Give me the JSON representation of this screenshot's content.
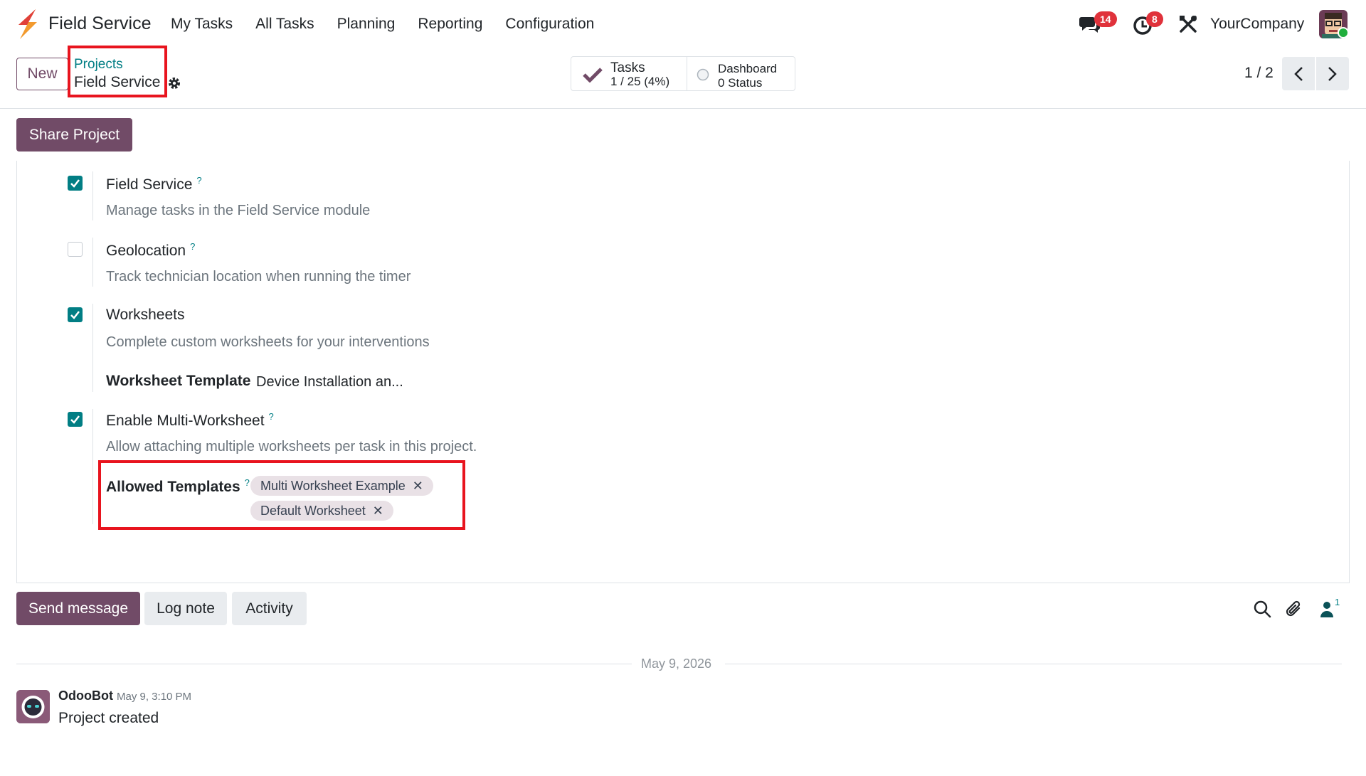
{
  "navbar": {
    "app_name": "Field Service",
    "menu": [
      "My Tasks",
      "All Tasks",
      "Planning",
      "Reporting",
      "Configuration"
    ],
    "messages_badge": "14",
    "activities_badge": "8",
    "company": "YourCompany"
  },
  "control_panel": {
    "new_label": "New",
    "breadcrumb_parent": "Projects",
    "breadcrumb_current": "Field Service",
    "smart_tasks_title": "Tasks",
    "smart_tasks_value": "1 / 25 (4%)",
    "smart_dashboard_title": "Dashboard",
    "smart_dashboard_value": "0 Status",
    "pager": "1 / 2"
  },
  "form": {
    "share_label": "Share Project",
    "settings": [
      {
        "label": "Field Service",
        "help": "?",
        "desc": "Manage tasks in the Field Service module",
        "checked": true
      },
      {
        "label": "Geolocation",
        "help": "?",
        "desc": "Track technician location when running the timer",
        "checked": false
      },
      {
        "label": "Worksheets",
        "help": "",
        "desc": "Complete custom worksheets for your interventions",
        "checked": true
      },
      {
        "label": "Enable Multi-Worksheet",
        "help": "?",
        "desc": "Allow attaching multiple worksheets per task in this project.",
        "checked": true
      }
    ],
    "worksheet_template_label": "Worksheet Template",
    "worksheet_template_value": "Device Installation an...",
    "allowed_templates_label": "Allowed Templates",
    "allowed_templates_help": "?",
    "allowed_templates": [
      "Multi Worksheet Example",
      "Default Worksheet"
    ],
    "tag_remove": "✕"
  },
  "chatter": {
    "send_label": "Send message",
    "log_label": "Log note",
    "activity_label": "Activity",
    "followers_count": "1",
    "date_separator": "May 9, 2026",
    "message": {
      "author": "OdooBot",
      "time": "May 9, 3:10 PM",
      "body": "Project created"
    }
  },
  "colors": {
    "brand": "#714b67",
    "accent": "#017e84",
    "highlight": "#e8141e"
  }
}
